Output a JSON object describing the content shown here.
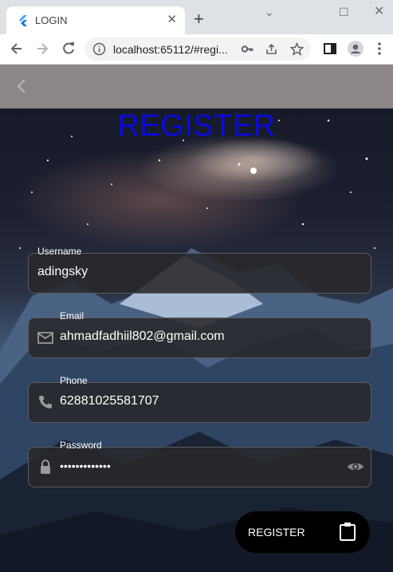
{
  "browser": {
    "tab_title": "LOGIN",
    "tab_close": "✕",
    "new_tab": "+",
    "window_controls": {
      "minimize": "⌄",
      "maximize": "☐",
      "close": "✕"
    },
    "url": "localhost:65112/#regi..."
  },
  "app": {
    "title": "REGISTER",
    "fields": [
      {
        "label": "Username",
        "value": "adingsky",
        "icon": ""
      },
      {
        "label": "Email",
        "value": "ahmadfadhiil802@gmail.com",
        "icon": "mail-icon"
      },
      {
        "label": "Phone",
        "value": "62881025581707",
        "icon": "phone-icon"
      },
      {
        "label": "Password",
        "value": "•••••••••••••",
        "icon": "lock-icon",
        "trailing_icon": "eye-icon"
      }
    ],
    "register_button": {
      "label": "REGISTER",
      "icon": "clipboard-icon"
    }
  },
  "colors": {
    "title": "#0b0bdc",
    "appbar": "#8c8686",
    "button": "#000000"
  }
}
